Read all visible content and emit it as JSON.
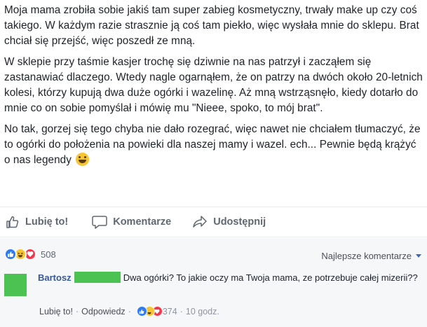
{
  "post": {
    "paragraphs": [
      "Moja mama zrobiła sobie jakiś tam super zabieg kosmetyczny, trwały make up czy coś takiego. W każdym razie strasznie ją coś tam piekło, więc wysłała mnie do sklepu. Brat chciał się przejść, więc poszedł ze mną.",
      "W sklepie przy taśmie kasjer trochę się dziwnie na nas patrzył i zacząłem się zastanawiać dlaczego. Wtedy nagle ogarnąłem, że on patrzy na dwóch około 20-letnich kolesi, którzy kupują dwa duże ogórki i wazelinę. Aż mną wstrząsnęło, kiedy dotarło do mnie co on sobie pomyślał i mówię mu \"Nieee, spoko, to mój brat\".",
      "No tak, gorzej się tego chyba nie dało rozegrać, więc nawet nie chciałem tłumaczyć, że to ogórki do położenia na powieki dla naszej mamy i wazel. ech... Pewnie będą krążyć o nas legendy"
    ],
    "emoji_icon": "grinning-face-emoji"
  },
  "actions": {
    "like_label": "Lubię to!",
    "comment_label": "Komentarze",
    "share_label": "Udostępnij"
  },
  "reactions": {
    "icons": [
      "like-icon",
      "haha-icon",
      "love-icon"
    ],
    "count": "508"
  },
  "sort": {
    "label": "Najlepsze komentarze"
  },
  "comment": {
    "author": "Bartosz",
    "text": "Dwa ogórki? To jakie oczy ma Twoja mama, ze potrzebuje całej mizerii??",
    "like_link": "Lubię to!",
    "reply_link": "Odpowiedz",
    "separator": "·",
    "reaction_count": "374",
    "time": "10 godz."
  },
  "colors": {
    "text": "#1d2129",
    "secondary": "#606770",
    "link": "#385898",
    "like_blue": "#2e7bf6",
    "haha_yellow": "#f7c531",
    "love_red": "#f0384f",
    "redaction_green": "#4cc253",
    "footer_bg": "#f6f7f9"
  }
}
